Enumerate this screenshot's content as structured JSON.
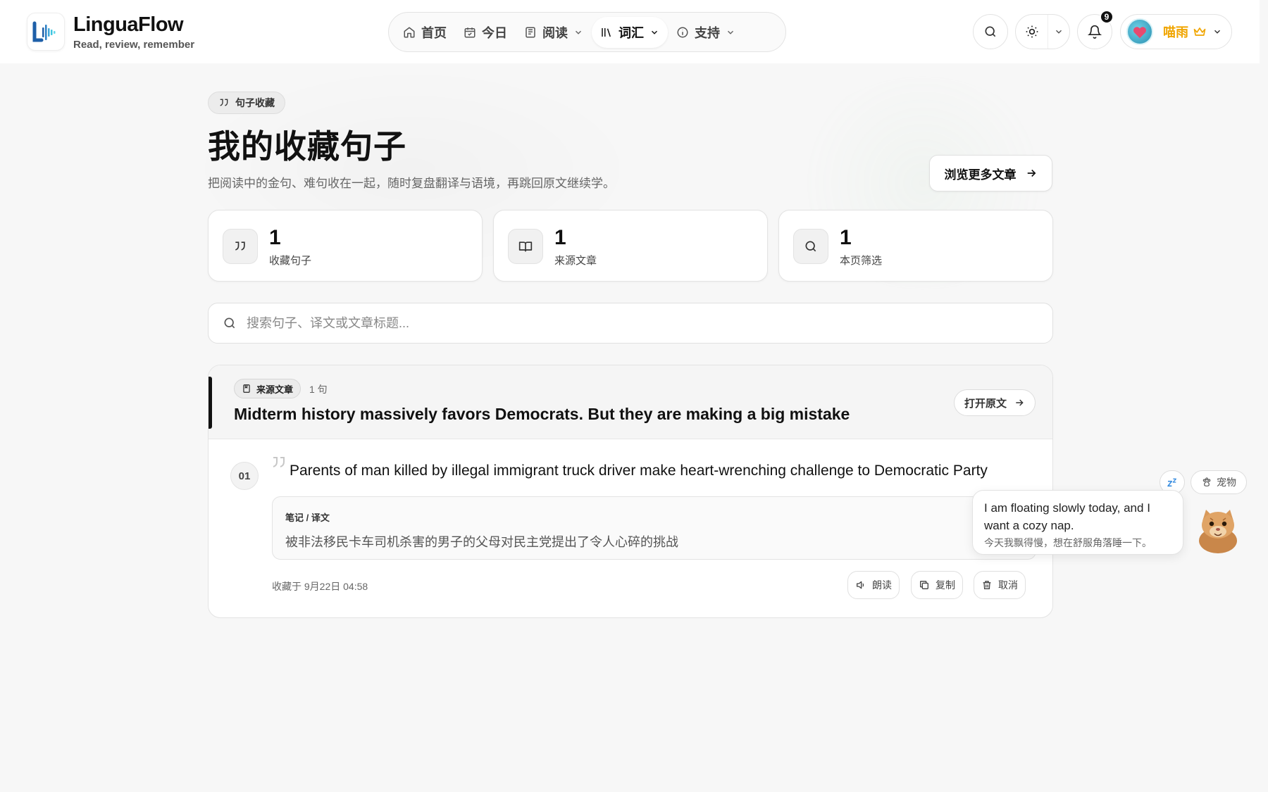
{
  "brand": {
    "name": "LinguaFlow",
    "tagline": "Read, review, remember"
  },
  "nav": {
    "items": [
      {
        "label": "首页",
        "icon": "home-icon"
      },
      {
        "label": "今日",
        "icon": "calendar-icon"
      },
      {
        "label": "阅读",
        "icon": "newspaper-icon",
        "dropdown": true
      },
      {
        "label": "词汇",
        "icon": "library-icon",
        "dropdown": true,
        "active": true
      },
      {
        "label": "支持",
        "icon": "info-icon",
        "dropdown": true
      }
    ]
  },
  "header": {
    "notifications_count": "9",
    "user_name": "喵雨",
    "icons": [
      "search-icon",
      "sun-icon",
      "chevron-down-icon",
      "bell-icon",
      "crown-icon"
    ]
  },
  "page": {
    "chip": "句子收藏",
    "title": "我的收藏句子",
    "subtitle": "把阅读中的金句、难句收在一起，随时复盘翻译与语境，再跳回原文继续学。",
    "browse_button": "浏览更多文章"
  },
  "stats": [
    {
      "value": "1",
      "label": "收藏句子",
      "icon": "quote-icon"
    },
    {
      "value": "1",
      "label": "来源文章",
      "icon": "book-open-icon"
    },
    {
      "value": "1",
      "label": "本页筛选",
      "icon": "search-icon"
    }
  ],
  "search": {
    "placeholder": "搜索句子、译文或文章标题...",
    "value": ""
  },
  "article": {
    "source_chip": "来源文章",
    "count": "1 句",
    "title": "Midterm history massively favors Democrats. But they are making a big mistake",
    "open_button": "打开原文",
    "sentences": [
      {
        "index": "01",
        "text": "Parents of man killed by illegal immigrant truck driver make heart-wrenching challenge to Democratic Party",
        "note_label": "笔记 / 译文",
        "note_text": "被非法移民卡车司机杀害的男子的父母对民主党提出了令人心碎的挑战",
        "saved_at": "收藏于 9月22日 04:58",
        "actions": {
          "read": "朗读",
          "copy": "复制",
          "cancel": "取消"
        }
      }
    ]
  },
  "pet": {
    "button_label": "宠物",
    "bubble_en": "I am floating slowly today, and I want a cozy nap.",
    "bubble_zh": "今天我飘得慢，想在舒服角落睡一下。"
  },
  "colors": {
    "accent": "#111111",
    "brand_blue": "#1e5fa8",
    "brand_cyan": "#3ec6e0",
    "user_name": "#f0a500"
  }
}
